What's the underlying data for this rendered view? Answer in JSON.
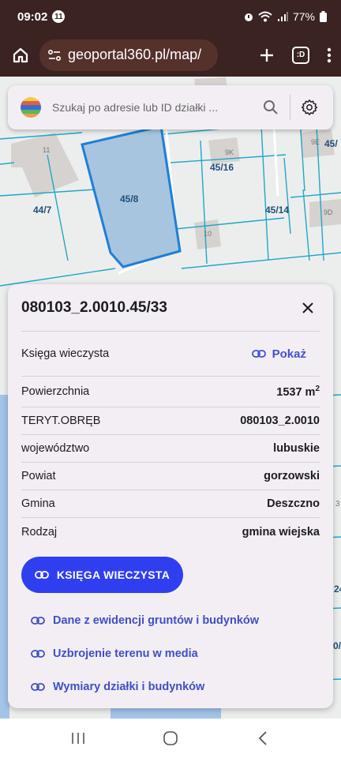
{
  "status_bar": {
    "time": "09:02",
    "notification_count": "11",
    "battery": "77%"
  },
  "browser": {
    "url": "geoportal360.pl/map/",
    "tab_label": ":D"
  },
  "search": {
    "placeholder": "Szukaj po adresie lub ID działki ..."
  },
  "map": {
    "labels": {
      "p11": "11",
      "p9k": "9K",
      "p45_16": "45/16",
      "p9e": "9E",
      "p45r": "45/",
      "p44_7": "44/7",
      "p45_8": "45/8",
      "p45_14": "45/14",
      "p9d": "9D",
      "p10": "10",
      "pr3": "3",
      "pr24": "24",
      "pr0": "0/"
    },
    "colors": {
      "parcel_fill": "#a7c5de",
      "parcel_stroke": "#1e7fd8",
      "boundary": "#1fa7c9",
      "building": "#d6d2cf"
    }
  },
  "panel": {
    "title": "080103_2.0010.45/33",
    "rows": [
      {
        "label": "Księga wieczysta",
        "link": "Pokaż"
      },
      {
        "label": "Powierzchnia",
        "value": "1537 m",
        "unit_sup": "2"
      },
      {
        "label": "TERYT.OBRĘB",
        "value": "080103_2.0010"
      },
      {
        "label": "województwo",
        "value": "lubuskie"
      },
      {
        "label": "Powiat",
        "value": "gorzowski"
      },
      {
        "label": "Gmina",
        "value": "Deszczno"
      },
      {
        "label": "Rodzaj",
        "value": "gmina wiejska"
      }
    ],
    "kw_button": "KSIĘGA WIECZYSTA",
    "links": [
      "Dane z ewidencji gruntów i budynków",
      "Uzbrojenie terenu w media",
      "Wymiary działki i budynków"
    ],
    "accent": "#2f3ff0",
    "link_color": "#3f4fc6"
  }
}
